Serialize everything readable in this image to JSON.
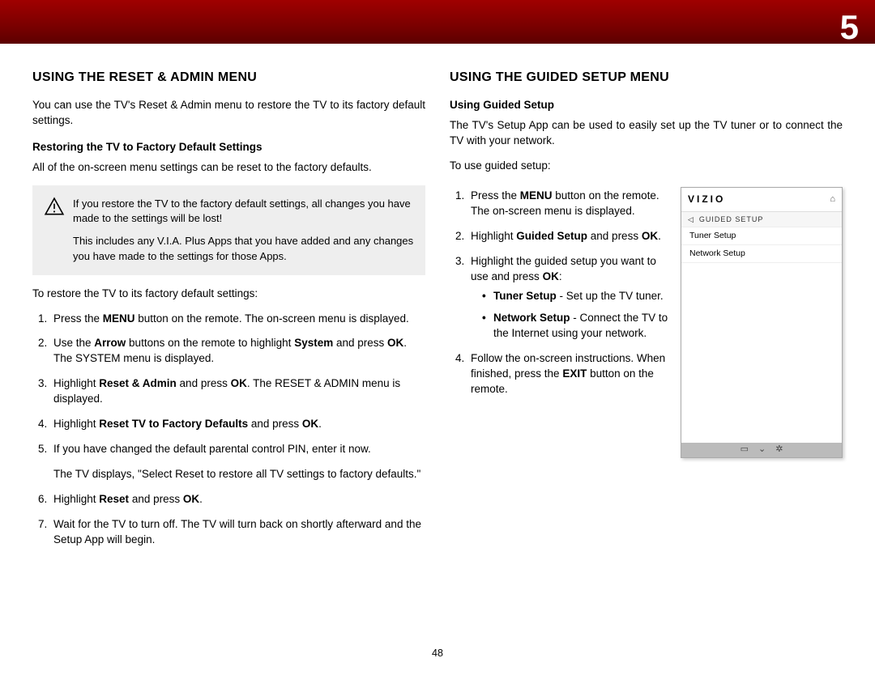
{
  "header": {
    "chapter_num": "5"
  },
  "page_number": "48",
  "left": {
    "heading": "USING THE RESET & ADMIN MENU",
    "intro": "You can use the TV's Reset & Admin menu to restore the TV to its factory default settings.",
    "subheading": "Restoring the TV to Factory Default Settings",
    "subintro": "All of the on-screen menu settings can be reset to the factory defaults.",
    "callout_main": "If you restore the TV to the factory default settings, all changes you have made to the settings will be lost!",
    "callout_sub": "This includes any V.I.A. Plus Apps that you have added and any changes you have made to the settings for those Apps.",
    "restore_lead": "To restore the TV to its factory default settings:",
    "step1_pre": "Press the ",
    "step1_b": "MENU",
    "step1_post": " button on the remote. The on-screen menu is displayed.",
    "step2_pre": "Use the ",
    "step2_b1": "Arrow",
    "step2_mid": " buttons on the remote to highlight ",
    "step2_b2": "System",
    "step2_post": " and press ",
    "step2_b3": "OK",
    "step2_tail": ". The SYSTEM menu is displayed.",
    "step3_pre": "Highlight ",
    "step3_b1": "Reset & Admin",
    "step3_mid": " and press ",
    "step3_b2": "OK",
    "step3_post": ". The RESET & ADMIN menu is displayed.",
    "step4_pre": "Highlight ",
    "step4_b1": "Reset TV to Factory Defaults",
    "step4_mid": " and press ",
    "step4_b2": "OK",
    "step4_post": ".",
    "step5": "If you have changed the default parental control PIN, enter it now.",
    "step5_after": "The TV displays, \"Select Reset to restore all TV settings to factory defaults.\"",
    "step6_pre": "Highlight ",
    "step6_b1": "Reset",
    "step6_mid": " and press ",
    "step6_b2": "OK",
    "step6_post": ".",
    "step7": "Wait for the TV to turn off. The TV will turn back on shortly afterward and the Setup App will begin."
  },
  "right": {
    "heading": "USING THE GUIDED SETUP MENU",
    "subheading": "Using Guided Setup",
    "intro": "The TV's Setup App can be used to easily set up the TV tuner or to connect the TV with your network.",
    "lead": "To use guided setup:",
    "step1_pre": "Press the ",
    "step1_b": "MENU",
    "step1_post": " button on the remote. The on-screen menu is displayed.",
    "step2_pre": "Highlight ",
    "step2_b1": "Guided Setup",
    "step2_mid": " and press ",
    "step2_b2": "OK",
    "step2_post": ".",
    "step3_pre": "Highlight the guided setup you want to use and press ",
    "step3_b": "OK",
    "step3_post": ":",
    "bullet1_b": "Tuner Setup",
    "bullet1_post": " - Set up the TV tuner.",
    "bullet2_b": "Network Setup",
    "bullet2_post": " - Connect the TV to the Internet using your network.",
    "step4_pre": "Follow the on-screen instructions. When finished, press the ",
    "step4_b": "EXIT",
    "step4_post": " button on the remote."
  },
  "menu": {
    "brand": "VIZIO",
    "crumb": "GUIDED SETUP",
    "item1": "Tuner Setup",
    "item2": "Network Setup"
  }
}
